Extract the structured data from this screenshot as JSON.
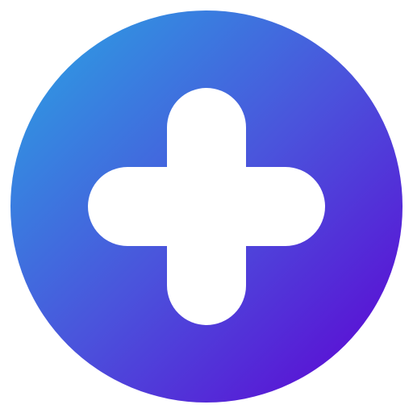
{
  "icon": {
    "name": "plus-icon",
    "shape": "circle-with-rounded-plus",
    "colors": {
      "gradient_start": "#29A6E3",
      "gradient_mid": "#4A55DC",
      "gradient_end": "#5E00D3",
      "glyph": "#FFFFFF",
      "background": "#FFFFFF"
    }
  }
}
